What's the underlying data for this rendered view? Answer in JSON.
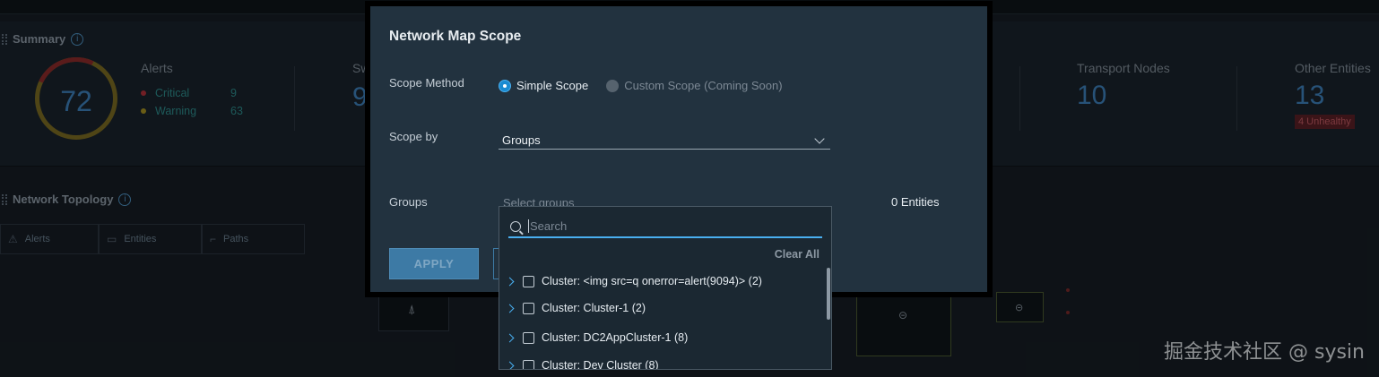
{
  "dashboard": {
    "summary_title": "Summary",
    "alerts_total": "72",
    "alerts_title": "Alerts",
    "critical_label": "Critical",
    "critical_count": "9",
    "warning_label": "Warning",
    "warning_count": "63",
    "sw_fragment": "Sw",
    "sw_num_fragment": "9",
    "transport_nodes_label": "Transport Nodes",
    "transport_nodes_count": "10",
    "other_entities_label": "Other Entities",
    "other_entities_count": "13",
    "unhealthy_badge": "4 Unhealthy",
    "topology_title": "Network Topology",
    "topology_tabs": [
      "Alerts",
      "Entities",
      "Paths"
    ],
    "colors": {
      "critical": "#b0303a",
      "warning": "#a39023",
      "accent": "#3d7fb8"
    }
  },
  "modal": {
    "title": "Network Map Scope",
    "scope_method_label": "Scope Method",
    "simple_scope_label": "Simple Scope",
    "custom_scope_label": "Custom Scope (Coming Soon)",
    "scope_by_label": "Scope by",
    "scope_by_value": "Groups",
    "groups_label": "Groups",
    "groups_placeholder": "Select groups",
    "entities_count": "0 Entities",
    "apply_label": "APPLY"
  },
  "dropdown": {
    "search_placeholder": "Search",
    "clear_all_label": "Clear All",
    "items": [
      "Cluster: <img src=q onerror=alert(9094)> (2)",
      "Cluster: Cluster-1 (2)",
      "Cluster: DC2AppCluster-1 (8)",
      "Cluster: Dev Cluster (8)"
    ]
  },
  "watermark": "掘金技术社区 @ sysin"
}
